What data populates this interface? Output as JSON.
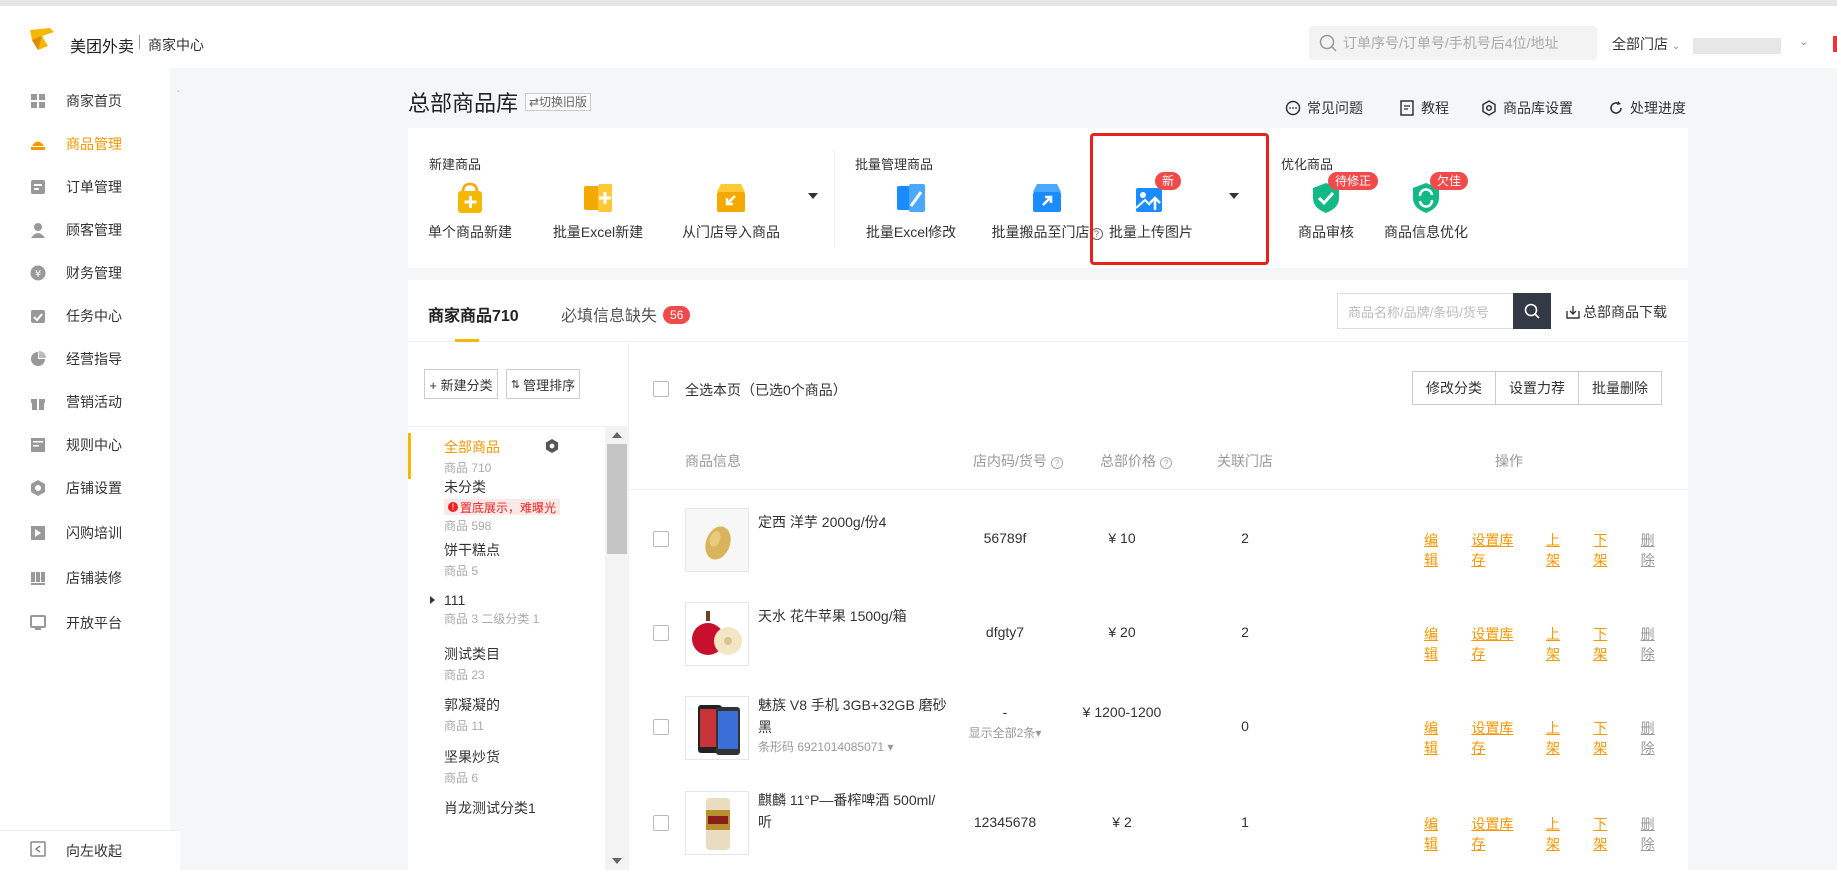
{
  "header": {
    "brand": "美团外卖",
    "brand_sub": "商家中心",
    "search_placeholder": "订单序号/订单号/手机号后4位/地址",
    "store_select": "全部门店"
  },
  "sidebar": {
    "items": [
      {
        "label": "商家首页",
        "icon": "grid-icon"
      },
      {
        "label": "商品管理",
        "icon": "goods-icon"
      },
      {
        "label": "订单管理",
        "icon": "order-icon"
      },
      {
        "label": "顾客管理",
        "icon": "customer-icon"
      },
      {
        "label": "财务管理",
        "icon": "yen-icon"
      },
      {
        "label": "任务中心",
        "icon": "task-icon"
      },
      {
        "label": "经营指导",
        "icon": "pie-icon"
      },
      {
        "label": "营销活动",
        "icon": "gift-icon"
      },
      {
        "label": "规则中心",
        "icon": "rules-icon"
      },
      {
        "label": "店铺设置",
        "icon": "settings-icon"
      },
      {
        "label": "闪购培训",
        "icon": "training-icon"
      },
      {
        "label": "店铺装修",
        "icon": "decor-icon"
      },
      {
        "label": "开放平台",
        "icon": "platform-icon"
      }
    ],
    "active_index": 1,
    "collapse_label": "向左收起"
  },
  "page": {
    "title": "总部商品库",
    "switch_old": "⇄切换旧版",
    "links": [
      "常见问题",
      "教程",
      "商品库设置",
      "处理进度"
    ]
  },
  "toolbar": {
    "groups": [
      "新建商品",
      "批量管理商品",
      "优化商品"
    ],
    "items": [
      {
        "label": "单个商品新建"
      },
      {
        "label": "批量Excel新建"
      },
      {
        "label": "从门店导入商品"
      },
      {
        "label": "批量Excel修改"
      },
      {
        "label": "批量搬品至门店"
      },
      {
        "label": "批量上传图片",
        "badge": "新"
      },
      {
        "label": "商品审核",
        "badge": "待修正"
      },
      {
        "label": "商品信息优化",
        "badge": "欠佳"
      }
    ],
    "accent": "#f5b800",
    "highlight_color": "#e8211a"
  },
  "tabs": {
    "goods": "商家商品710",
    "missing": "必填信息缺失",
    "missing_count": "56",
    "search_placeholder": "商品名称/品牌/条码/货号",
    "download": "总部商品下载"
  },
  "categories": {
    "new_btn": "+ 新建分类",
    "sort_btn": "管理排序",
    "items": [
      {
        "name": "全部商品",
        "count": "商品 710"
      },
      {
        "name": "未分类",
        "warn": "置底展示，难曝光",
        "count": "商品 598"
      },
      {
        "name": "饼干糕点",
        "count": "商品 5"
      },
      {
        "name": "111",
        "count": "商品 3 二级分类 1"
      },
      {
        "name": "测试类目",
        "count": "商品 23"
      },
      {
        "name": "郭凝凝的",
        "count": "商品 11"
      },
      {
        "name": "坚果炒货",
        "count": "商品 6"
      },
      {
        "name": "肖龙测试分类1",
        "count": ""
      }
    ]
  },
  "products": {
    "select_all": "全选本页（已选0个商品）",
    "actions": [
      "修改分类",
      "设置力荐",
      "批量删除"
    ],
    "columns": [
      "商品信息",
      "店内码/货号",
      "总部价格",
      "关联门店",
      "操作"
    ],
    "row_ops": [
      "编辑",
      "设置库存",
      "上架",
      "下架",
      "删除"
    ],
    "rows": [
      {
        "name": "定西 洋芋 2000g/份4",
        "code": "56789f",
        "price": "¥ 10",
        "stores": "2"
      },
      {
        "name": "天水 花牛苹果 1500g/箱",
        "code": "dfgty7",
        "price": "¥ 20",
        "stores": "2"
      },
      {
        "name": "魅族 V8 手机 3GB+32GB 磨砂黑",
        "barcode": "条形码 6921014085071",
        "code": "-",
        "code_sub": "显示全部2条",
        "price": "¥ 1200-1200",
        "stores": "0"
      },
      {
        "name": "麒麟 11°P—番榨啤酒 500ml/听",
        "code": "12345678",
        "price": "¥ 2",
        "stores": "1"
      }
    ]
  }
}
